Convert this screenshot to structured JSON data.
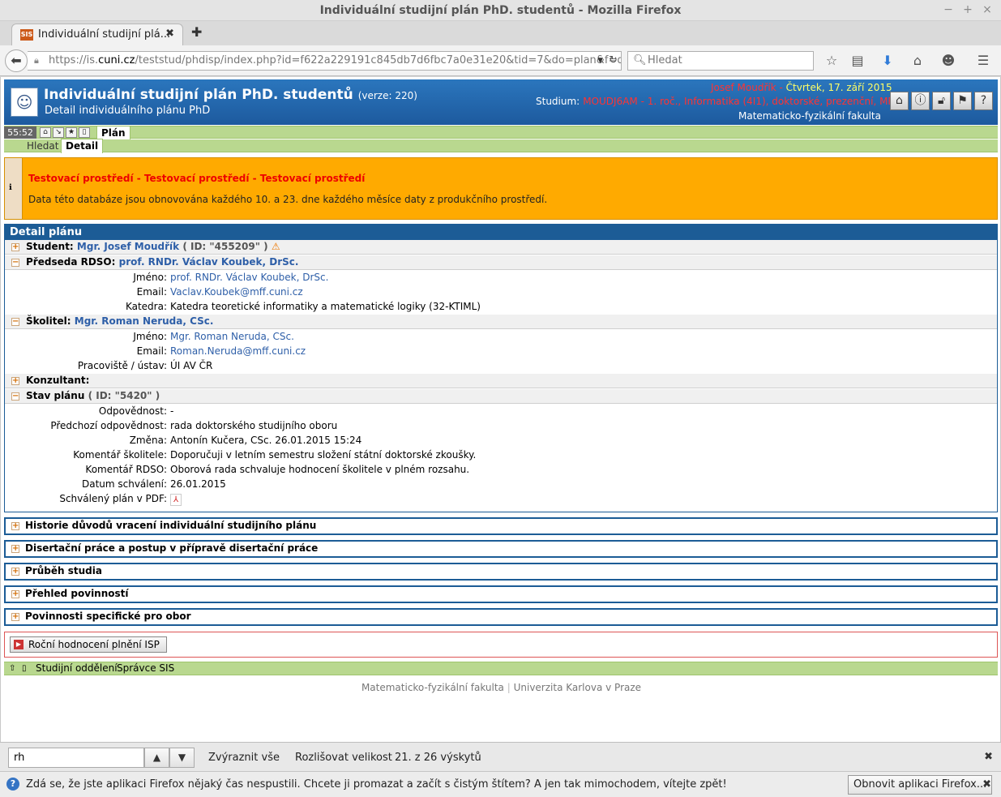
{
  "window": {
    "title": "Individuální studijní plán PhD. studentů - Mozilla Firefox"
  },
  "browser": {
    "tab_title": "Individuální studijní plá...",
    "tab_favicon": "SIS",
    "url_prefix": "https://is.",
    "url_domain": "cuni.cz",
    "url_rest": "/teststud/phdisp/index.php?id=f622a229191c845db7d6fbc7a0e31e20&tid=7&do=plan&f=d",
    "search_placeholder": "Hledat"
  },
  "sis": {
    "title": "Individuální studijní plán PhD. studentů",
    "version": "(verze: 220)",
    "subtitle": "Detail individuálního plánu PhD",
    "user": "Josef Moudřík",
    "separator": " - ",
    "date": "Čtvrtek, 17. září 2015",
    "study_label": "Studium:",
    "study_value": "MOUDJ6AM - 1. roč., Informatika (4I1), doktorské, prezenční, MFF",
    "faculty": "Matematicko-fyzikální fakulta",
    "timer": "55:52",
    "tab_plan": "Plán",
    "tab_search": "Hledat",
    "tab_detail": "Detail"
  },
  "warning": {
    "title": "Testovací prostředí - Testovací prostředí - Testovací prostředí",
    "text": "Data této databáze jsou obnovována každého 10. a 23. dne každého měsíce daty z produkčního prostředí."
  },
  "detail": {
    "heading": "Detail plánu",
    "student_label": "Student:",
    "student_name": "Mgr. Josef Moudřík",
    "student_id": "( ID: \"455209\" )",
    "chair_label": "Předseda RDSO:",
    "chair_name": "prof. RNDr. Václav Koubek, DrSc.",
    "chair_fields": [
      {
        "k": "Jméno:",
        "v": "prof. RNDr. Václav Koubek, DrSc."
      },
      {
        "k": "Email:",
        "v": "Vaclav.Koubek@mff.cuni.cz"
      },
      {
        "k": "Katedra:",
        "v": "Katedra teoretické informatiky a matematické logiky (32-KTIML)"
      }
    ],
    "supervisor_label": "Školitel:",
    "supervisor_name": "Mgr. Roman Neruda, CSc.",
    "supervisor_fields": [
      {
        "k": "Jméno:",
        "v": "Mgr. Roman Neruda, CSc."
      },
      {
        "k": "Email:",
        "v": "Roman.Neruda@mff.cuni.cz"
      },
      {
        "k": "Pracoviště / ústav:",
        "v": "ÚI AV ČR"
      }
    ],
    "consultant_label": "Konzultant:",
    "state_label": "Stav plánu",
    "state_id": "( ID: \"5420\" )",
    "state_fields": [
      {
        "k": "Odpovědnost:",
        "v": "-"
      },
      {
        "k": "Předchozí odpovědnost:",
        "v": "rada doktorského studijního oboru"
      },
      {
        "k": "Změna:",
        "v": "Antonín Kučera, CSc. 26.01.2015 15:24"
      },
      {
        "k": "Komentář školitele:",
        "v": "Doporučuji v letním semestru složení státní doktorské zkoušky."
      },
      {
        "k": "Komentář RDSO:",
        "v": "Oborová rada schvaluje hodnocení školitele v plném rozsahu."
      },
      {
        "k": "Datum schválení:",
        "v": "26.01.2015"
      },
      {
        "k": "Schválený plán v PDF:",
        "v": ""
      }
    ]
  },
  "sections": [
    "Historie důvodů vracení individuální studijního plánu",
    "Disertační práce a postup v přípravě disertační práce",
    "Průběh studia",
    "Přehled povinností",
    "Povinnosti specifické pro obor"
  ],
  "isp_button": "Roční hodnocení plnění ISP",
  "footer": {
    "link1": "Studijní oddělení",
    "link2": "Správce SIS",
    "credit1": "Matematicko-fyzikální fakulta",
    "credit_sep": " | ",
    "credit2": "Univerzita Karlova v Praze"
  },
  "findbar": {
    "query": "rh",
    "highlight_all": "Zvýraznit vše",
    "match_case": "Rozlišovat velikost",
    "status": "21. z 26 výskytů"
  },
  "notification": {
    "message": "Zdá se, že jste aplikaci Firefox nějaký čas nespustili. Chcete ji promazat a začít s čistým štítem? A jen tak mimochodem, vítejte zpět!",
    "button": "Obnovit aplikaci Firefox..."
  }
}
